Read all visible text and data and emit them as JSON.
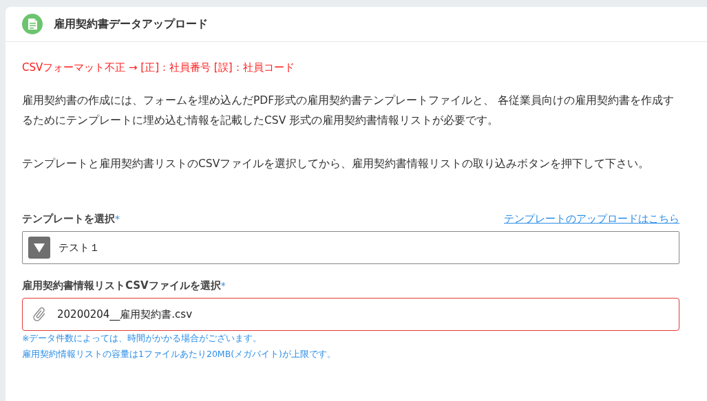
{
  "panel": {
    "title": "雇用契約書データアップロード"
  },
  "error_message": "CSVフォーマット不正 → [正]：社員番号 [誤]：社員コード",
  "paragraphs": [
    "雇用契約書の作成には、フォームを埋め込んだPDF形式の雇用契約書テンプレートファイルと、 各従業員向けの雇用契約書を作成するためにテンプレートに埋め込む情報を記載したCSV 形式の雇用契約書情報リストが必要です。",
    "テンプレートと雇用契約書リストのCSVファイルを選択してから、雇用契約書情報リストの取り込みボタンを押下して下さい。"
  ],
  "fields": [
    {
      "kind": "select",
      "label": "テンプレートを選択",
      "required_mark": "*",
      "link": "テンプレートのアップロードはこちら",
      "value": "テスト１",
      "error": false
    },
    {
      "kind": "file",
      "label": "雇用契約書情報リストCSVファイルを選択",
      "required_mark": "*",
      "value": "20200204__雇用契約書.csv",
      "error": true,
      "notes": [
        "※データ件数によっては、時間がかかる場合がございます。",
        "雇用契約情報リストの容量は1ファイルあたり20MB(メガバイト)が上限です。"
      ]
    }
  ]
}
